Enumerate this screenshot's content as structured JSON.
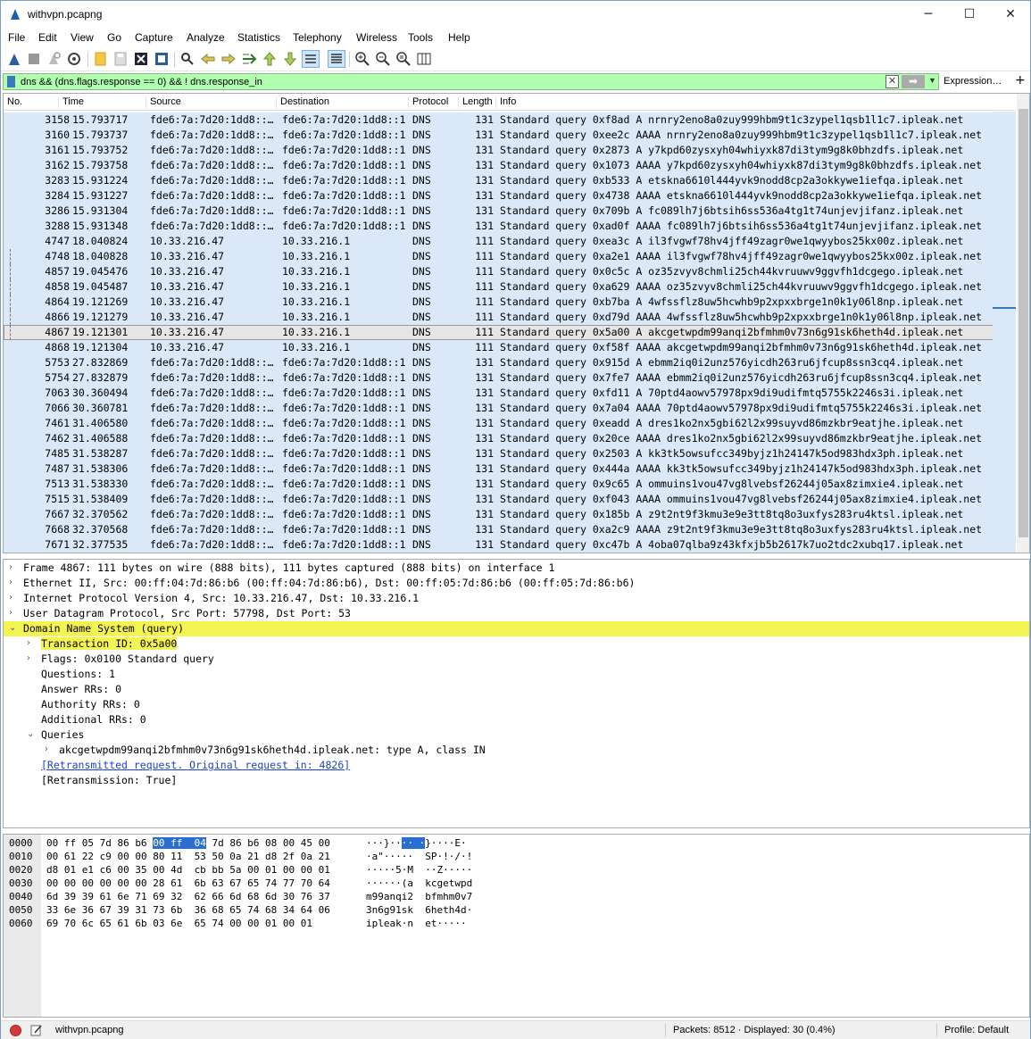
{
  "window": {
    "title": "withvpn.pcapng",
    "min": "─",
    "max": "☐",
    "close": "✕"
  },
  "menu": [
    "File",
    "Edit",
    "View",
    "Go",
    "Capture",
    "Analyze",
    "Statistics",
    "Telephony",
    "Wireless",
    "Tools",
    "Help"
  ],
  "filter": {
    "value": "dns && (dns.flags.response == 0) && ! dns.response_in",
    "expression_label": "Expression…",
    "plus": "+"
  },
  "columns": [
    "No.",
    "Time",
    "Source",
    "Destination",
    "Protocol",
    "Length",
    "Info"
  ],
  "packets": [
    [
      "3158",
      "15.793717",
      "fde6:7a:7d20:1dd8::…",
      "fde6:7a:7d20:1dd8::1",
      "DNS",
      "131",
      "Standard query 0xf8ad A nrnry2eno8a0zuy999hbm9t1c3zypel1qsb1l1c7.ipleak.net"
    ],
    [
      "3160",
      "15.793737",
      "fde6:7a:7d20:1dd8::…",
      "fde6:7a:7d20:1dd8::1",
      "DNS",
      "131",
      "Standard query 0xee2c AAAA nrnry2eno8a0zuy999hbm9t1c3zypel1qsb1l1c7.ipleak.net"
    ],
    [
      "3161",
      "15.793752",
      "fde6:7a:7d20:1dd8::…",
      "fde6:7a:7d20:1dd8::1",
      "DNS",
      "131",
      "Standard query 0x2873 A y7kpd60zysxyh04whiyxk87di3tym9g8k0bhzdfs.ipleak.net"
    ],
    [
      "3162",
      "15.793758",
      "fde6:7a:7d20:1dd8::…",
      "fde6:7a:7d20:1dd8::1",
      "DNS",
      "131",
      "Standard query 0x1073 AAAA y7kpd60zysxyh04whiyxk87di3tym9g8k0bhzdfs.ipleak.net"
    ],
    [
      "3283",
      "15.931224",
      "fde6:7a:7d20:1dd8::…",
      "fde6:7a:7d20:1dd8::1",
      "DNS",
      "131",
      "Standard query 0xb533 A etskna6610l444yvk9nodd8cp2a3okkywe1iefqa.ipleak.net"
    ],
    [
      "3284",
      "15.931227",
      "fde6:7a:7d20:1dd8::…",
      "fde6:7a:7d20:1dd8::1",
      "DNS",
      "131",
      "Standard query 0x4738 AAAA etskna6610l444yvk9nodd8cp2a3okkywe1iefqa.ipleak.net"
    ],
    [
      "3286",
      "15.931304",
      "fde6:7a:7d20:1dd8::…",
      "fde6:7a:7d20:1dd8::1",
      "DNS",
      "131",
      "Standard query 0x709b A fc089lh7j6btsih6ss536a4tg1t74unjevjifanz.ipleak.net"
    ],
    [
      "3288",
      "15.931348",
      "fde6:7a:7d20:1dd8::…",
      "fde6:7a:7d20:1dd8::1",
      "DNS",
      "131",
      "Standard query 0xad0f AAAA fc089lh7j6btsih6ss536a4tg1t74unjevjifanz.ipleak.net"
    ],
    [
      "4747",
      "18.040824",
      "10.33.216.47",
      "10.33.216.1",
      "DNS",
      "111",
      "Standard query 0xea3c A il3fvgwf78hv4jff49zagr0we1qwyybos25kx00z.ipleak.net"
    ],
    [
      "4748",
      "18.040828",
      "10.33.216.47",
      "10.33.216.1",
      "DNS",
      "111",
      "Standard query 0xa2e1 AAAA il3fvgwf78hv4jff49zagr0we1qwyybos25kx00z.ipleak.net"
    ],
    [
      "4857",
      "19.045476",
      "10.33.216.47",
      "10.33.216.1",
      "DNS",
      "111",
      "Standard query 0x0c5c A oz35zvyv8chmli25ch44kvruuwv9ggvfh1dcgego.ipleak.net"
    ],
    [
      "4858",
      "19.045487",
      "10.33.216.47",
      "10.33.216.1",
      "DNS",
      "111",
      "Standard query 0xa629 AAAA oz35zvyv8chmli25ch44kvruuwv9ggvfh1dcgego.ipleak.net"
    ],
    [
      "4864",
      "19.121269",
      "10.33.216.47",
      "10.33.216.1",
      "DNS",
      "111",
      "Standard query 0xb7ba A 4wfssflz8uw5hcwhb9p2xpxxbrge1n0k1y06l8np.ipleak.net"
    ],
    [
      "4866",
      "19.121279",
      "10.33.216.47",
      "10.33.216.1",
      "DNS",
      "111",
      "Standard query 0xd79d AAAA 4wfssflz8uw5hcwhb9p2xpxxbrge1n0k1y06l8np.ipleak.net"
    ],
    [
      "4867",
      "19.121301",
      "10.33.216.47",
      "10.33.216.1",
      "DNS",
      "111",
      "Standard query 0x5a00 A akcgetwpdm99anqi2bfmhm0v73n6g91sk6heth4d.ipleak.net"
    ],
    [
      "4868",
      "19.121304",
      "10.33.216.47",
      "10.33.216.1",
      "DNS",
      "111",
      "Standard query 0xf58f AAAA akcgetwpdm99anqi2bfmhm0v73n6g91sk6heth4d.ipleak.net"
    ],
    [
      "5753",
      "27.832869",
      "fde6:7a:7d20:1dd8::…",
      "fde6:7a:7d20:1dd8::1",
      "DNS",
      "131",
      "Standard query 0x915d A ebmm2iq0i2unz576yicdh263ru6jfcup8ssn3cq4.ipleak.net"
    ],
    [
      "5754",
      "27.832879",
      "fde6:7a:7d20:1dd8::…",
      "fde6:7a:7d20:1dd8::1",
      "DNS",
      "131",
      "Standard query 0x7fe7 AAAA ebmm2iq0i2unz576yicdh263ru6jfcup8ssn3cq4.ipleak.net"
    ],
    [
      "7063",
      "30.360494",
      "fde6:7a:7d20:1dd8::…",
      "fde6:7a:7d20:1dd8::1",
      "DNS",
      "131",
      "Standard query 0xfd11 A 70ptd4aowv57978px9di9udifmtq5755k2246s3i.ipleak.net"
    ],
    [
      "7066",
      "30.360781",
      "fde6:7a:7d20:1dd8::…",
      "fde6:7a:7d20:1dd8::1",
      "DNS",
      "131",
      "Standard query 0x7a04 AAAA 70ptd4aowv57978px9di9udifmtq5755k2246s3i.ipleak.net"
    ],
    [
      "7461",
      "31.406580",
      "fde6:7a:7d20:1dd8::…",
      "fde6:7a:7d20:1dd8::1",
      "DNS",
      "131",
      "Standard query 0xeadd A dres1ko2nx5gbi62l2x99suyvd86mzkbr9eatjhe.ipleak.net"
    ],
    [
      "7462",
      "31.406588",
      "fde6:7a:7d20:1dd8::…",
      "fde6:7a:7d20:1dd8::1",
      "DNS",
      "131",
      "Standard query 0x20ce AAAA dres1ko2nx5gbi62l2x99suyvd86mzkbr9eatjhe.ipleak.net"
    ],
    [
      "7485",
      "31.538287",
      "fde6:7a:7d20:1dd8::…",
      "fde6:7a:7d20:1dd8::1",
      "DNS",
      "131",
      "Standard query 0x2503 A kk3tk5owsufcc349byjz1h24147k5od983hdx3ph.ipleak.net"
    ],
    [
      "7487",
      "31.538306",
      "fde6:7a:7d20:1dd8::…",
      "fde6:7a:7d20:1dd8::1",
      "DNS",
      "131",
      "Standard query 0x444a AAAA kk3tk5owsufcc349byjz1h24147k5od983hdx3ph.ipleak.net"
    ],
    [
      "7513",
      "31.538330",
      "fde6:7a:7d20:1dd8::…",
      "fde6:7a:7d20:1dd8::1",
      "DNS",
      "131",
      "Standard query 0x9c65 A ommuins1vou47vg8lvebsf26244j05ax8zimxie4.ipleak.net"
    ],
    [
      "7515",
      "31.538409",
      "fde6:7a:7d20:1dd8::…",
      "fde6:7a:7d20:1dd8::1",
      "DNS",
      "131",
      "Standard query 0xf043 AAAA ommuins1vou47vg8lvebsf26244j05ax8zimxie4.ipleak.net"
    ],
    [
      "7667",
      "32.370562",
      "fde6:7a:7d20:1dd8::…",
      "fde6:7a:7d20:1dd8::1",
      "DNS",
      "131",
      "Standard query 0x185b A z9t2nt9f3kmu3e9e3tt8tq8o3uxfys283ru4ktsl.ipleak.net"
    ],
    [
      "7668",
      "32.370568",
      "fde6:7a:7d20:1dd8::…",
      "fde6:7a:7d20:1dd8::1",
      "DNS",
      "131",
      "Standard query 0xa2c9 AAAA z9t2nt9f3kmu3e9e3tt8tq8o3uxfys283ru4ktsl.ipleak.net"
    ],
    [
      "7671",
      "32.377535",
      "fde6:7a:7d20:1dd8::…",
      "fde6:7a:7d20:1dd8::1",
      "DNS",
      "131",
      "Standard query 0xc47b A 4oba07qlba9z43kfxjb5b2617k7uo2tdc2xubq17.ipleak.net"
    ]
  ],
  "selected_packet": "4867",
  "details": [
    "Frame 4867: 111 bytes on wire (888 bits), 111 bytes captured (888 bits) on interface 1",
    "Ethernet II, Src: 00:ff:04:7d:86:b6 (00:ff:04:7d:86:b6), Dst: 00:ff:05:7d:86:b6 (00:ff:05:7d:86:b6)",
    "Internet Protocol Version 4, Src: 10.33.216.47, Dst: 10.33.216.1",
    "User Datagram Protocol, Src Port: 57798, Dst Port: 53",
    "Domain Name System (query)",
    "Transaction ID: 0x5a00",
    "Flags: 0x0100 Standard query",
    "Questions: 1",
    "Answer RRs: 0",
    "Authority RRs: 0",
    "Additional RRs: 0",
    "Queries",
    "akcgetwpdm99anqi2bfmhm0v73n6g91sk6heth4d.ipleak.net: type A, class IN",
    "[Retransmitted request. Original request in: 4826]",
    "[Retransmission: True]"
  ],
  "hex": [
    {
      "off": "0000",
      "b1": "00 ff 05 7d 86 b6 ",
      "bs": "00 ff  04",
      "b2": " 7d 86 b6 08 00 45 00",
      "a1": "···}··",
      "as": "·· ·",
      "a2": "}····E·"
    },
    {
      "off": "0010",
      "b1": "00 61 22 c9 00 00 80 11  53 50 0a 21 d8 2f 0a 21",
      "bs": "",
      "b2": "",
      "a1": "·a\"·····  SP·!·/·!",
      "as": "",
      "a2": ""
    },
    {
      "off": "0020",
      "b1": "d8 01 e1 c6 00 35 00 4d  cb bb 5a 00 01 00 00 01",
      "bs": "",
      "b2": "",
      "a1": "·····5·M  ··Z·····",
      "as": "",
      "a2": ""
    },
    {
      "off": "0030",
      "b1": "00 00 00 00 00 00 28 61  6b 63 67 65 74 77 70 64",
      "bs": "",
      "b2": "",
      "a1": "······(a  kcgetwpd",
      "as": "",
      "a2": ""
    },
    {
      "off": "0040",
      "b1": "6d 39 39 61 6e 71 69 32  62 66 6d 68 6d 30 76 37",
      "bs": "",
      "b2": "",
      "a1": "m99anqi2  bfmhm0v7",
      "as": "",
      "a2": ""
    },
    {
      "off": "0050",
      "b1": "33 6e 36 67 39 31 73 6b  36 68 65 74 68 34 64 06",
      "bs": "",
      "b2": "",
      "a1": "3n6g91sk  6heth4d·",
      "as": "",
      "a2": ""
    },
    {
      "off": "0060",
      "b1": "69 70 6c 65 61 6b 03 6e  65 74 00 00 01 00 01",
      "bs": "",
      "b2": "",
      "a1": "ipleak·n  et·····",
      "as": "",
      "a2": ""
    }
  ],
  "status": {
    "file": "withvpn.pcapng",
    "packets": "Packets: 8512 · Displayed: 30 (0.4%)",
    "profile": "Profile: Default"
  },
  "colors": {
    "row_bg": "#dae8f8",
    "filter_ok": "#afffaf",
    "highlight": "#f3f352",
    "byte_sel": "#2a6ed0"
  }
}
